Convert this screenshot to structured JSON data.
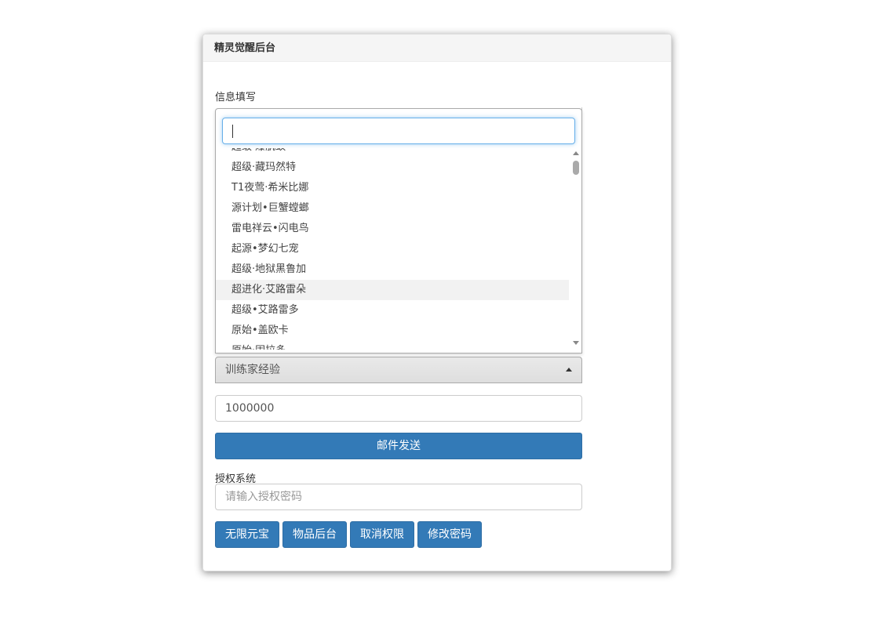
{
  "panel": {
    "title": "精灵觉醒后台"
  },
  "info_section": {
    "label": "信息填写"
  },
  "dropdown": {
    "search_value": "",
    "items": [
      {
        "label": "超级·爆肌蚊"
      },
      {
        "label": "超级·藏玛然特"
      },
      {
        "label": "T1夜莺·希米比娜"
      },
      {
        "label": "源计划•巨蟹螳螂"
      },
      {
        "label": "雷电祥云•闪电鸟"
      },
      {
        "label": "起源•梦幻七宠"
      },
      {
        "label": "超级·地狱黑鲁加"
      },
      {
        "label": "超进化·艾路雷朵",
        "highlighted": true
      },
      {
        "label": "超级•艾路雷多"
      },
      {
        "label": "原始•盖欧卡"
      },
      {
        "label": "原始·固拉多"
      }
    ]
  },
  "mail_type_select": {
    "value": "训练家经验"
  },
  "amount_input": {
    "value": "1000000"
  },
  "send_button": {
    "label": "邮件发送"
  },
  "auth_section": {
    "label": "授权系统",
    "placeholder": "请输入授权密码"
  },
  "action_buttons": {
    "unlimited_gold": "无限元宝",
    "item_backend": "物品后台",
    "revoke_permission": "取消权限",
    "change_password": "修改密码"
  },
  "colors": {
    "primary": "#337ab7",
    "focus": "#66afe9",
    "danger": "#c0392b"
  }
}
